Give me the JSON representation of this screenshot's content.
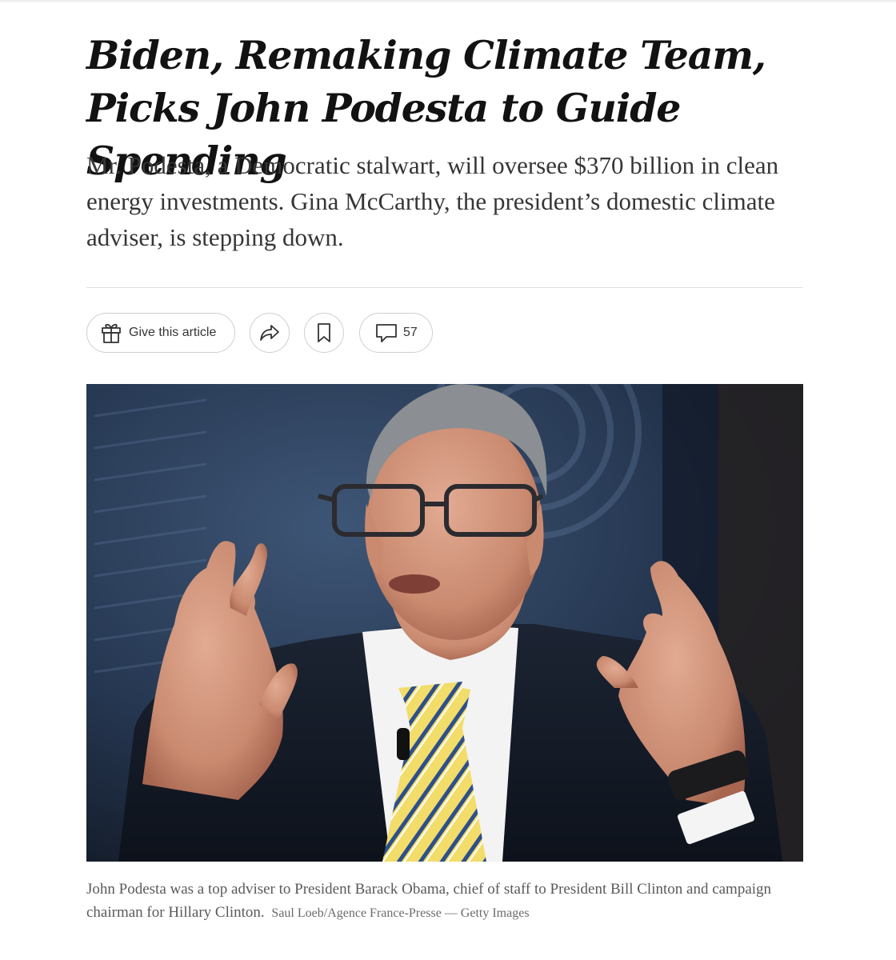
{
  "article": {
    "headline": "Biden, Remaking Climate Team, Picks John Podesta to Guide Spending",
    "summary": "Mr. Podesta, a Democratic stalwart, will oversee $370 billion in clean energy investments. Gina McCarthy, the president’s domestic climate adviser, is stepping down."
  },
  "actions": {
    "give_label": "Give this article",
    "give_icon": "gift-icon",
    "share_icon": "share-arrow-icon",
    "save_icon": "bookmark-icon",
    "comment_icon": "comment-bubble-icon",
    "comment_count": "57"
  },
  "photo": {
    "caption": "John Podesta was a top adviser to President Barack Obama, chief of staff to President Bill Clinton and campaign chairman for Hillary Clinton.",
    "credit": "Saul Loeb/Agence France-Presse — Getty Images"
  },
  "colors": {
    "text": "#121212",
    "summary_text": "#363636",
    "caption_text": "#5a5a5a",
    "divider": "#dfdfdf",
    "pill_border": "#cfcfcf"
  }
}
